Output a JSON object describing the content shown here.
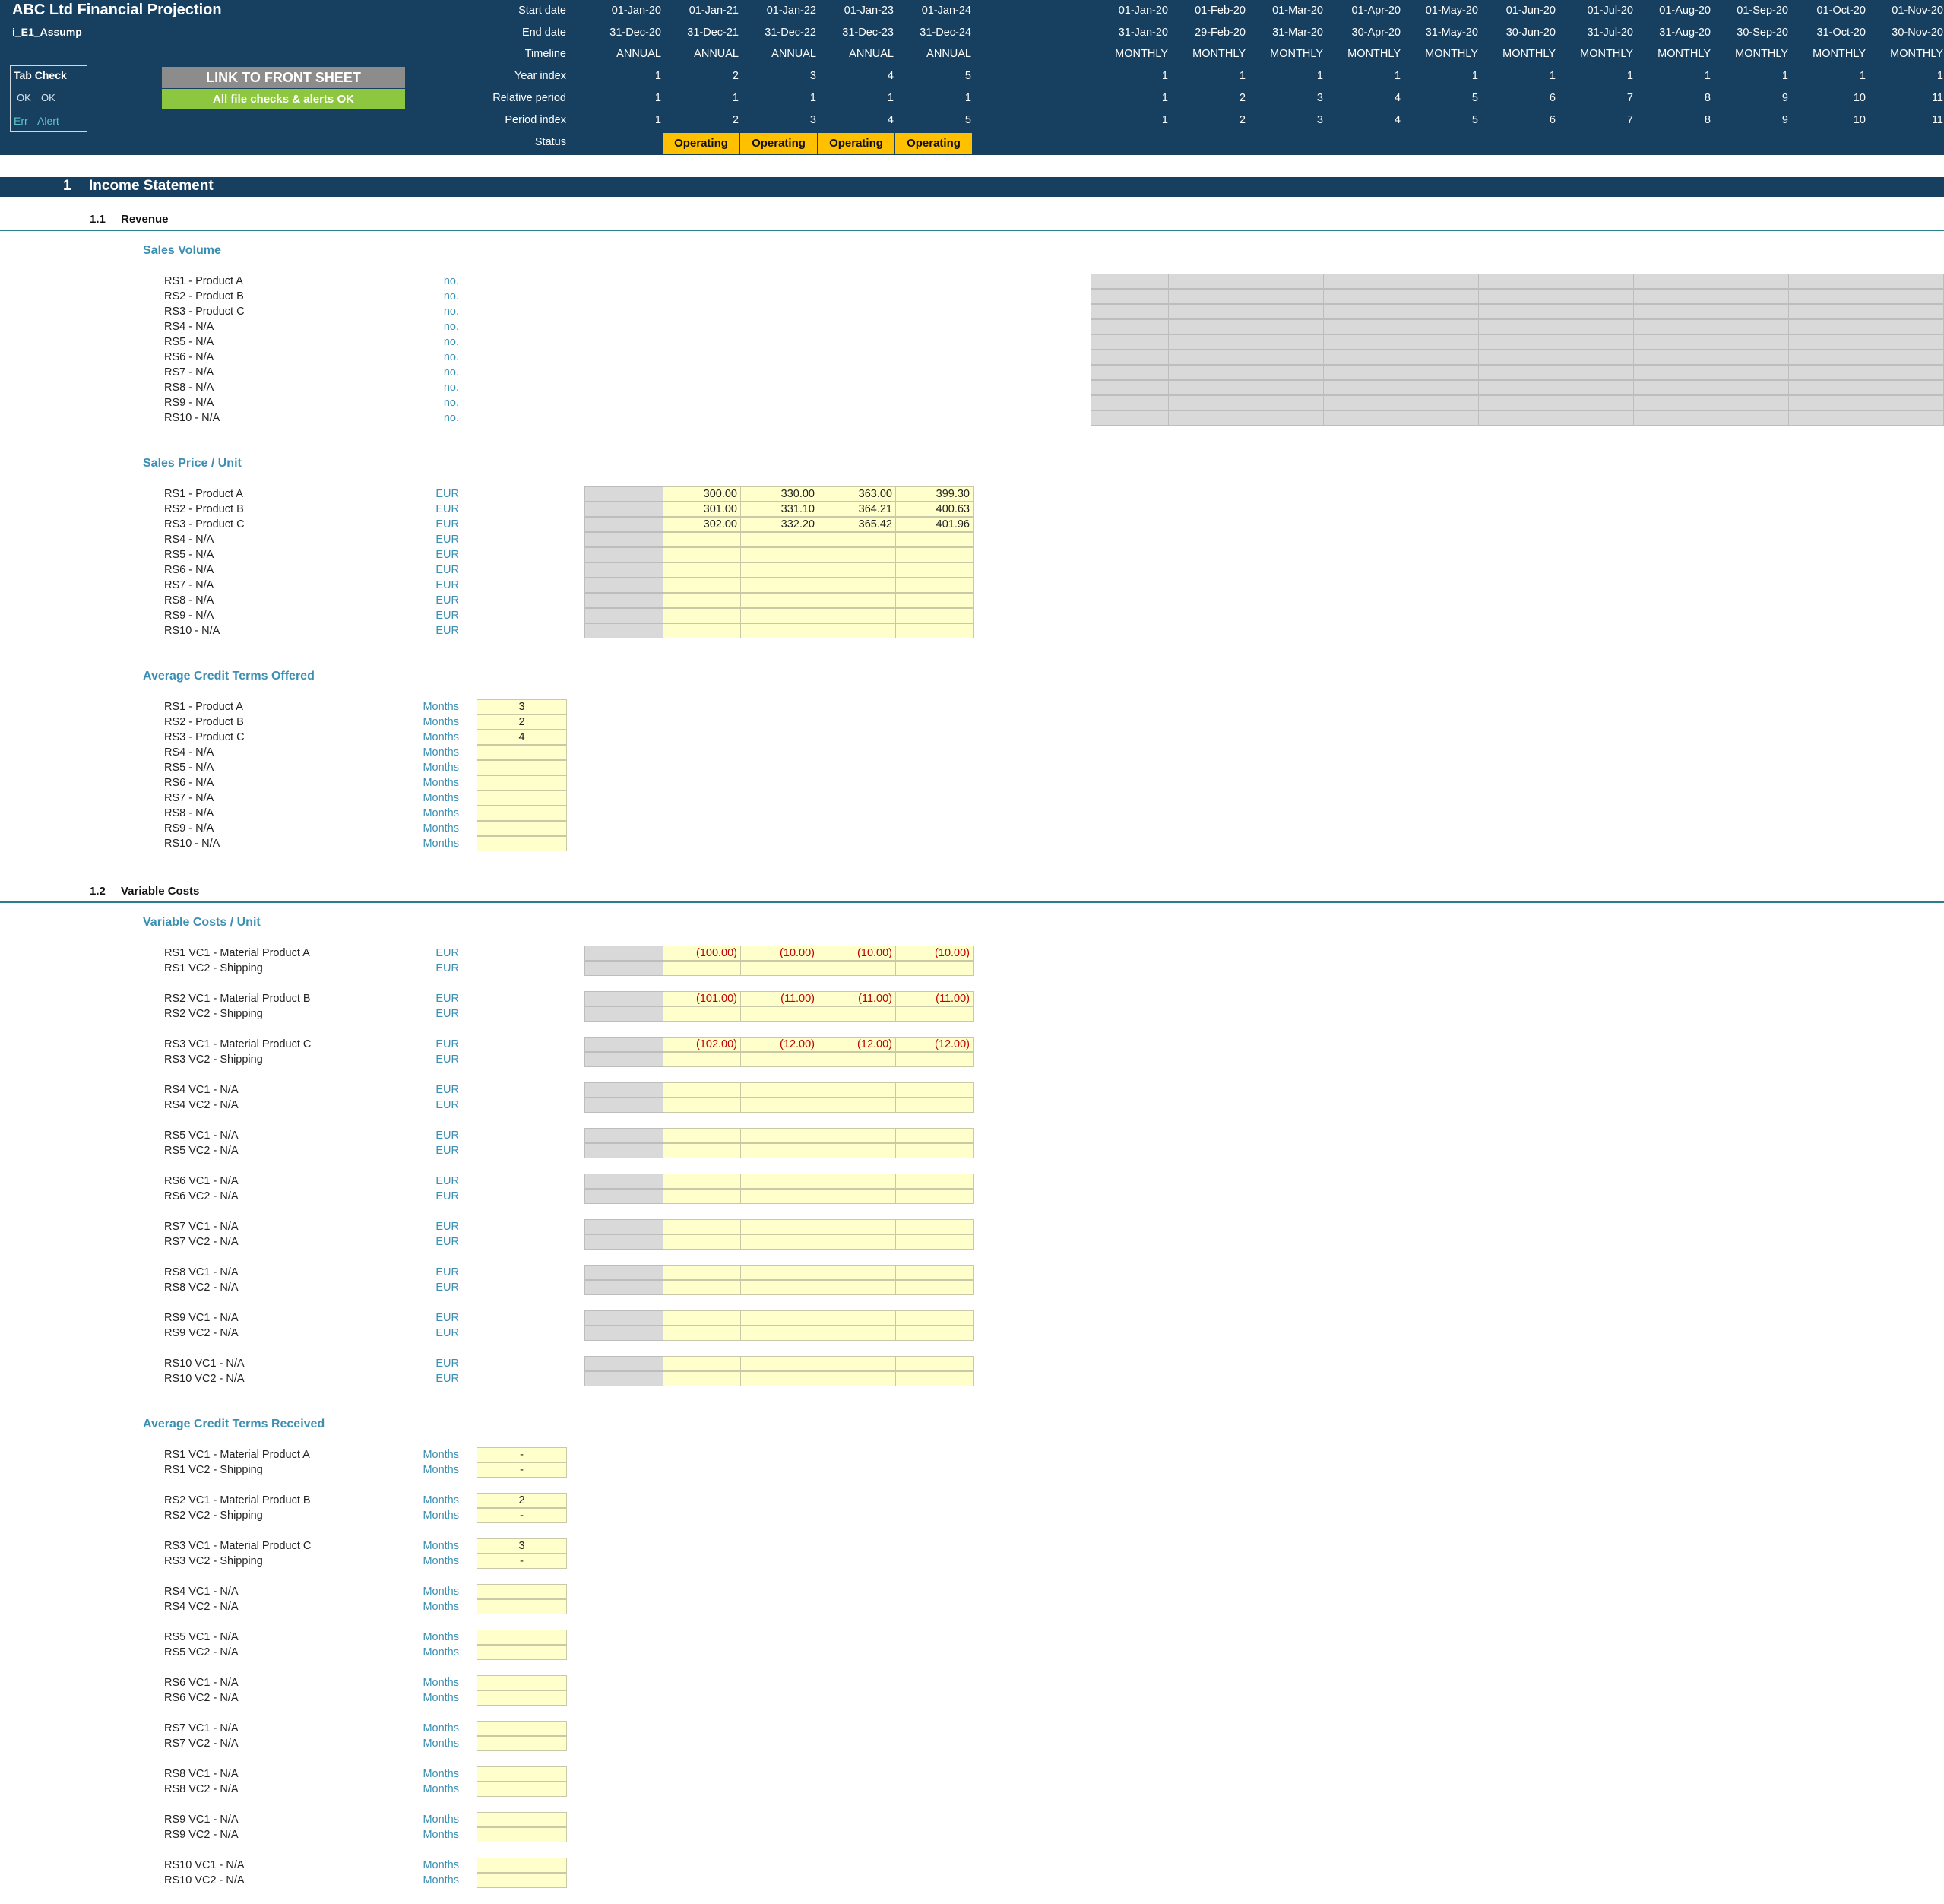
{
  "header": {
    "title": "ABC Ltd Financial Projection",
    "sheet": "i_E1_Assump",
    "tab_check": {
      "title": "Tab Check",
      "ok1": "OK",
      "ok2": "OK",
      "err": "Err",
      "alert": "Alert"
    },
    "link_button": "LINK TO FRONT SHEET",
    "checks_status": "All file checks & alerts OK",
    "row_labels": [
      "Start date",
      "End date",
      "Timeline",
      "Year index",
      "Relative period",
      "Period index",
      "Status"
    ],
    "annual": {
      "start": [
        "01-Jan-20",
        "01-Jan-21",
        "01-Jan-22",
        "01-Jan-23",
        "01-Jan-24"
      ],
      "end": [
        "31-Dec-20",
        "31-Dec-21",
        "31-Dec-22",
        "31-Dec-23",
        "31-Dec-24"
      ],
      "timeline": [
        "ANNUAL",
        "ANNUAL",
        "ANNUAL",
        "ANNUAL",
        "ANNUAL"
      ],
      "year_index": [
        "1",
        "2",
        "3",
        "4",
        "5"
      ],
      "relative": [
        "1",
        "1",
        "1",
        "1",
        "1"
      ],
      "period_index": [
        "1",
        "2",
        "3",
        "4",
        "5"
      ],
      "status": [
        "Operating",
        "Operating",
        "Operating",
        "Operating"
      ]
    },
    "monthly": {
      "start": [
        "01-Jan-20",
        "01-Feb-20",
        "01-Mar-20",
        "01-Apr-20",
        "01-May-20",
        "01-Jun-20",
        "01-Jul-20",
        "01-Aug-20",
        "01-Sep-20",
        "01-Oct-20",
        "01-Nov-20"
      ],
      "end": [
        "31-Jan-20",
        "29-Feb-20",
        "31-Mar-20",
        "30-Apr-20",
        "31-May-20",
        "30-Jun-20",
        "31-Jul-20",
        "31-Aug-20",
        "30-Sep-20",
        "31-Oct-20",
        "30-Nov-20"
      ],
      "timeline": [
        "MONTHLY",
        "MONTHLY",
        "MONTHLY",
        "MONTHLY",
        "MONTHLY",
        "MONTHLY",
        "MONTHLY",
        "MONTHLY",
        "MONTHLY",
        "MONTHLY",
        "MONTHLY"
      ],
      "year_index": [
        "1",
        "1",
        "1",
        "1",
        "1",
        "1",
        "1",
        "1",
        "1",
        "1",
        "1"
      ],
      "relative": [
        "1",
        "2",
        "3",
        "4",
        "5",
        "6",
        "7",
        "8",
        "9",
        "10",
        "11"
      ],
      "period_index": [
        "1",
        "2",
        "3",
        "4",
        "5",
        "6",
        "7",
        "8",
        "9",
        "10",
        "11"
      ]
    }
  },
  "section": {
    "num": "1",
    "title": "Income Statement"
  },
  "revenue": {
    "num": "1.1",
    "title": "Revenue",
    "sales_volume": {
      "title": "Sales Volume",
      "labels": [
        "RS1 - Product A",
        "RS2 - Product B",
        "RS3 - Product C",
        "RS4 - N/A",
        "RS5 - N/A",
        "RS6 - N/A",
        "RS7 - N/A",
        "RS8 - N/A",
        "RS9 - N/A",
        "RS10 - N/A"
      ],
      "unit": "no."
    },
    "sales_price": {
      "title": "Sales Price / Unit",
      "labels": [
        "RS1 - Product A",
        "RS2 - Product B",
        "RS3 - Product C",
        "RS4 - N/A",
        "RS5 - N/A",
        "RS6 - N/A",
        "RS7 - N/A",
        "RS8 - N/A",
        "RS9 - N/A",
        "RS10 - N/A"
      ],
      "unit": "EUR",
      "values": [
        [
          "300.00",
          "330.00",
          "363.00",
          "399.30"
        ],
        [
          "301.00",
          "331.10",
          "364.21",
          "400.63"
        ],
        [
          "302.00",
          "332.20",
          "365.42",
          "401.96"
        ],
        [
          "",
          "",
          "",
          ""
        ],
        [
          "",
          "",
          "",
          ""
        ],
        [
          "",
          "",
          "",
          ""
        ],
        [
          "",
          "",
          "",
          ""
        ],
        [
          "",
          "",
          "",
          ""
        ],
        [
          "",
          "",
          "",
          ""
        ],
        [
          "",
          "",
          "",
          ""
        ]
      ]
    },
    "credit_offered": {
      "title": "Average Credit Terms Offered",
      "labels": [
        "RS1 - Product A",
        "RS2 - Product B",
        "RS3 - Product C",
        "RS4 - N/A",
        "RS5 - N/A",
        "RS6 - N/A",
        "RS7 - N/A",
        "RS8 - N/A",
        "RS9 - N/A",
        "RS10 - N/A"
      ],
      "unit": "Months",
      "values": [
        "3",
        "2",
        "4",
        "",
        "",
        "",
        "",
        "",
        "",
        ""
      ]
    }
  },
  "variable": {
    "num": "1.2",
    "title": "Variable Costs",
    "costs": {
      "title": "Variable Costs / Unit",
      "unit": "EUR",
      "pairs": [
        {
          "l1": "RS1 VC1 - Material Product A",
          "l2": "RS1 VC2 - Shipping",
          "v": [
            "(100.00)",
            "(10.00)",
            "(10.00)",
            "(10.00)"
          ]
        },
        {
          "l1": "RS2 VC1 - Material Product B",
          "l2": "RS2 VC2 - Shipping",
          "v": [
            "(101.00)",
            "(11.00)",
            "(11.00)",
            "(11.00)"
          ]
        },
        {
          "l1": "RS3 VC1 - Material Product C",
          "l2": "RS3 VC2 - Shipping",
          "v": [
            "(102.00)",
            "(12.00)",
            "(12.00)",
            "(12.00)"
          ]
        },
        {
          "l1": "RS4 VC1 - N/A",
          "l2": "RS4 VC2 - N/A",
          "v": [
            "",
            "",
            "",
            ""
          ]
        },
        {
          "l1": "RS5 VC1 - N/A",
          "l2": "RS5 VC2 - N/A",
          "v": [
            "",
            "",
            "",
            ""
          ]
        },
        {
          "l1": "RS6 VC1 - N/A",
          "l2": "RS6 VC2 - N/A",
          "v": [
            "",
            "",
            "",
            ""
          ]
        },
        {
          "l1": "RS7 VC1 - N/A",
          "l2": "RS7 VC2 - N/A",
          "v": [
            "",
            "",
            "",
            ""
          ]
        },
        {
          "l1": "RS8 VC1 - N/A",
          "l2": "RS8 VC2 - N/A",
          "v": [
            "",
            "",
            "",
            ""
          ]
        },
        {
          "l1": "RS9 VC1 - N/A",
          "l2": "RS9 VC2 - N/A",
          "v": [
            "",
            "",
            "",
            ""
          ]
        },
        {
          "l1": "RS10 VC1 - N/A",
          "l2": "RS10 VC2 - N/A",
          "v": [
            "",
            "",
            "",
            ""
          ]
        }
      ]
    },
    "credit_received": {
      "title": "Average Credit Terms Received",
      "unit": "Months",
      "pairs": [
        {
          "l1": "RS1 VC1 - Material Product A",
          "l2": "RS1 VC2 - Shipping",
          "v1": "-",
          "v2": "-"
        },
        {
          "l1": "RS2 VC1 - Material Product B",
          "l2": "RS2 VC2 - Shipping",
          "v1": "2",
          "v2": "-"
        },
        {
          "l1": "RS3 VC1 - Material Product C",
          "l2": "RS3 VC2 - Shipping",
          "v1": "3",
          "v2": "-"
        },
        {
          "l1": "RS4 VC1 - N/A",
          "l2": "RS4 VC2 - N/A",
          "v1": "",
          "v2": ""
        },
        {
          "l1": "RS5 VC1 - N/A",
          "l2": "RS5 VC2 - N/A",
          "v1": "",
          "v2": ""
        },
        {
          "l1": "RS6 VC1 - N/A",
          "l2": "RS6 VC2 - N/A",
          "v1": "",
          "v2": ""
        },
        {
          "l1": "RS7 VC1 - N/A",
          "l2": "RS7 VC2 - N/A",
          "v1": "",
          "v2": ""
        },
        {
          "l1": "RS8 VC1 - N/A",
          "l2": "RS8 VC2 - N/A",
          "v1": "",
          "v2": ""
        },
        {
          "l1": "RS9 VC1 - N/A",
          "l2": "RS9 VC2 - N/A",
          "v1": "",
          "v2": ""
        },
        {
          "l1": "RS10 VC1 - N/A",
          "l2": "RS10 VC2 - N/A",
          "v1": "",
          "v2": ""
        }
      ]
    }
  },
  "colors": {
    "header_bg": "#173f5f",
    "input_yellow": "#ffffcc",
    "status_orange": "#ffc000",
    "ok_green": "#8dc63f",
    "label_teal": "#3a8fb2",
    "negative_red": "#c00000"
  }
}
